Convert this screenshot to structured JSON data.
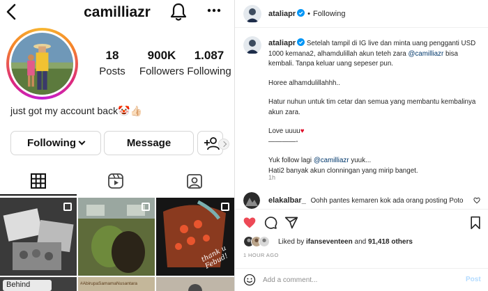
{
  "profile": {
    "username": "camilliazr",
    "stats": [
      {
        "value": "18",
        "label": "Posts"
      },
      {
        "value": "900K",
        "label": "Followers"
      },
      {
        "value": "1.087",
        "label": "Following"
      }
    ],
    "bio_text": "just got my account back",
    "bio_emoji": "🤡👍🏻",
    "following_button": "Following",
    "message_button": "Message",
    "grid_thumb_texts": [
      "Behind",
      "#AbirupaSamamaNusantara",
      "thank u Febud!"
    ]
  },
  "post": {
    "author": "ataliapr",
    "follow_state": "Following",
    "separator": "•",
    "caption_lines": [
      {
        "prefix": "Setelah tampil di IG live dan minta uang pengganti USD 1000 kemana2, alhamdulillah akun teteh zara ",
        "mention": "@camilliazr",
        "suffix": " bisa kembali. Tanpa keluar uang sepeser pun."
      },
      {
        "text": "Horee alhamdulillahhh.."
      },
      {
        "text": "Hatur nuhun untuk tim cetar dan semua yang membantu kembalinya akun zara."
      },
      {
        "text": "Love uuuu",
        "emoji": "♥"
      },
      {
        "text": "————-"
      },
      {
        "prefix": "Yuk follow lagi ",
        "mention": "@camilliazr",
        "suffix": " yuuk..."
      },
      {
        "text": "Hati2 banyak akun clonningan yang mirip banget."
      }
    ],
    "ago": "1h",
    "comment_user": "elakalbar_",
    "comment_text": "Oohh pantes kemaren kok ada orang posting Poto",
    "liked_by_prefix": "Liked by ",
    "liked_by_user": "ifanseventeen",
    "liked_by_and": " and ",
    "liked_by_count": "91,418 others",
    "timestamp": "1 HOUR AGO",
    "comment_placeholder": "Add a comment...",
    "post_button": "Post"
  },
  "colors": {
    "text": "#262626",
    "secondary": "#8e8e8e",
    "link": "#00376b",
    "verified": "#0095f6",
    "like_red": "#ed4956",
    "post_btn_disabled": "#b3dbff"
  },
  "icons": [
    "back-arrow-icon",
    "bell-icon",
    "more-dots-icon",
    "add-user-icon",
    "grid-icon",
    "reels-icon",
    "tagged-icon",
    "verified-icon",
    "heart-icon",
    "comment-icon",
    "share-icon",
    "bookmark-icon",
    "smile-icon"
  ]
}
